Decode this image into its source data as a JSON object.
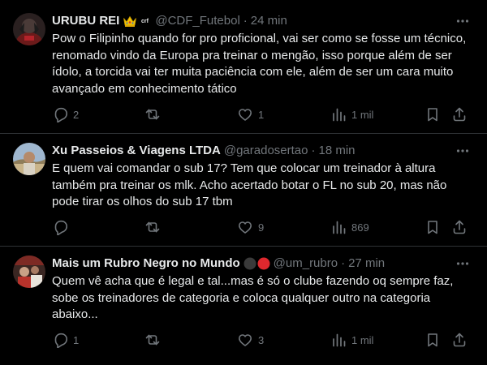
{
  "tweets": [
    {
      "name": "URUBU REI",
      "badge_text": "crf",
      "handle": "@CDF_Futebol",
      "time": "24 min",
      "text": "Pow o Filipinho quando for pro proficional, vai ser como se fosse um técnico, renomado vindo da Europa pra treinar o mengão, isso porque além de ser ídolo, a torcida vai ter muita paciência com ele, além de ser um cara muito avançado em conhecimento tático",
      "replies": "2",
      "retweets": "",
      "likes": "1",
      "views": "1 mil"
    },
    {
      "name": "Xu Passeios & Viagens LTDA",
      "handle": "@garadosertao",
      "time": "18 min",
      "text": "E quem vai comandar o sub 17? Tem que colocar um treinador à altura também pra treinar os mlk. Acho acertado botar o FL no sub 20, mas não pode tirar os olhos do sub 17 tbm",
      "replies": "",
      "retweets": "",
      "likes": "9",
      "views": "869"
    },
    {
      "name": "Mais um Rubro Negro no Mundo",
      "handle": "@um_rubro",
      "time": "27 min",
      "text": "Quem vê acha que é legal e tal...mas é só o clube fazendo oq sempre faz, sobe os treinadores de categoria e coloca qualquer outro na categoria abaixo...",
      "replies": "1",
      "retweets": "",
      "likes": "3",
      "views": "1 mil"
    }
  ],
  "icons": {
    "reply": "reply-icon",
    "retweet": "retweet-icon",
    "like": "heart-icon",
    "views": "views-icon",
    "bookmark": "bookmark-icon",
    "share": "share-icon",
    "more": "more-icon"
  },
  "colors": {
    "background": "#000000",
    "text": "#e7e9ea",
    "muted": "#71767b",
    "divider": "#2f3336",
    "crown": "#f5c400",
    "flamengo_red": "#e0282e"
  }
}
